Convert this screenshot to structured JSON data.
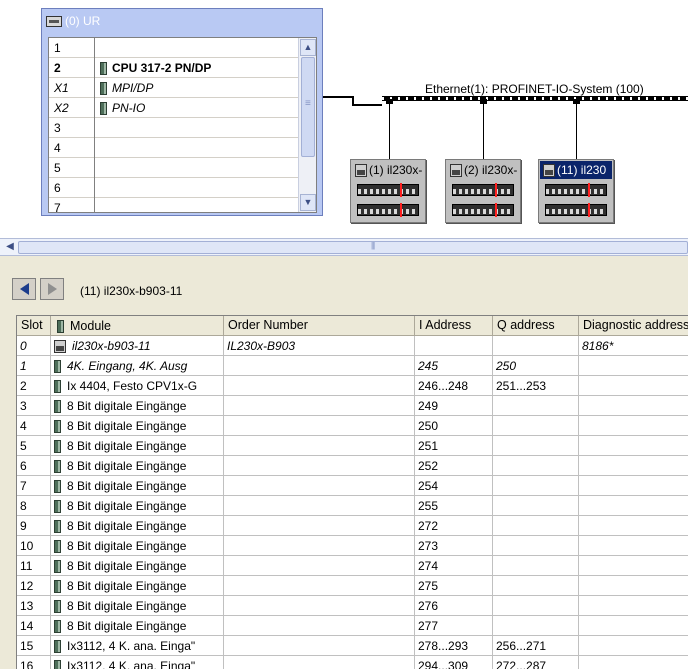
{
  "rack": {
    "title": "(0) UR",
    "rows": [
      {
        "slot": "1",
        "module": "",
        "style": ""
      },
      {
        "slot": "2",
        "module": "CPU 317-2 PN/DP",
        "style": "bold",
        "icon": true
      },
      {
        "slot": "X1",
        "module": "MPI/DP",
        "style": "italic",
        "icon": true
      },
      {
        "slot": "X2",
        "module": "PN-IO",
        "style": "italic",
        "icon": true
      },
      {
        "slot": "3",
        "module": "",
        "style": ""
      },
      {
        "slot": "4",
        "module": "",
        "style": ""
      },
      {
        "slot": "5",
        "module": "",
        "style": ""
      },
      {
        "slot": "6",
        "module": "",
        "style": ""
      },
      {
        "slot": "7",
        "module": "",
        "style": ""
      }
    ]
  },
  "network": {
    "label": "Ethernet(1): PROFINET-IO-System (100)",
    "devices": [
      {
        "label": "(1) il230x-",
        "selected": false
      },
      {
        "label": "(2) il230x-",
        "selected": false
      },
      {
        "label": "(11) il230",
        "selected": true
      }
    ]
  },
  "detail": {
    "title": "(11)   il230x-b903-11",
    "headers": {
      "slot": "Slot",
      "module": "Module",
      "order": "Order Number",
      "i_address": "I Address",
      "q_address": "Q address",
      "diag": "Diagnostic address"
    },
    "rows": [
      {
        "slot": "0",
        "module": "il230x-b903-11",
        "order": "IL230x-B903",
        "i": "",
        "q": "",
        "diag": "8186*",
        "italic": true,
        "head": true
      },
      {
        "slot": "1",
        "module": "4K. Eingang, 4K. Ausg",
        "order": "",
        "i": "245",
        "q": "250",
        "diag": "",
        "italic": true
      },
      {
        "slot": "2",
        "module": "Ix 4404, Festo CPV1x-G",
        "order": "",
        "i": "246...248",
        "q": "251...253",
        "diag": ""
      },
      {
        "slot": "3",
        "module": "8 Bit digitale Eingänge",
        "order": "",
        "i": "249",
        "q": "",
        "diag": ""
      },
      {
        "slot": "4",
        "module": "8 Bit digitale Eingänge",
        "order": "",
        "i": "250",
        "q": "",
        "diag": ""
      },
      {
        "slot": "5",
        "module": "8 Bit digitale Eingänge",
        "order": "",
        "i": "251",
        "q": "",
        "diag": ""
      },
      {
        "slot": "6",
        "module": "8 Bit digitale Eingänge",
        "order": "",
        "i": "252",
        "q": "",
        "diag": ""
      },
      {
        "slot": "7",
        "module": "8 Bit digitale Eingänge",
        "order": "",
        "i": "254",
        "q": "",
        "diag": ""
      },
      {
        "slot": "8",
        "module": "8 Bit digitale Eingänge",
        "order": "",
        "i": "255",
        "q": "",
        "diag": ""
      },
      {
        "slot": "9",
        "module": "8 Bit digitale Eingänge",
        "order": "",
        "i": "272",
        "q": "",
        "diag": ""
      },
      {
        "slot": "10",
        "module": "8 Bit digitale Eingänge",
        "order": "",
        "i": "273",
        "q": "",
        "diag": ""
      },
      {
        "slot": "11",
        "module": "8 Bit digitale Eingänge",
        "order": "",
        "i": "274",
        "q": "",
        "diag": ""
      },
      {
        "slot": "12",
        "module": "8 Bit digitale Eingänge",
        "order": "",
        "i": "275",
        "q": "",
        "diag": ""
      },
      {
        "slot": "13",
        "module": "8 Bit digitale Eingänge",
        "order": "",
        "i": "276",
        "q": "",
        "diag": ""
      },
      {
        "slot": "14",
        "module": "8 Bit digitale Eingänge",
        "order": "",
        "i": "277",
        "q": "",
        "diag": ""
      },
      {
        "slot": "15",
        "module": "Ix3112, 4 K. ana. Einga\"",
        "order": "",
        "i": "278...293",
        "q": "256...271",
        "diag": ""
      },
      {
        "slot": "16",
        "module": "Ix3112, 4 K. ana. Einga\"",
        "order": "",
        "i": "294...309",
        "q": "272...287",
        "diag": ""
      }
    ]
  }
}
